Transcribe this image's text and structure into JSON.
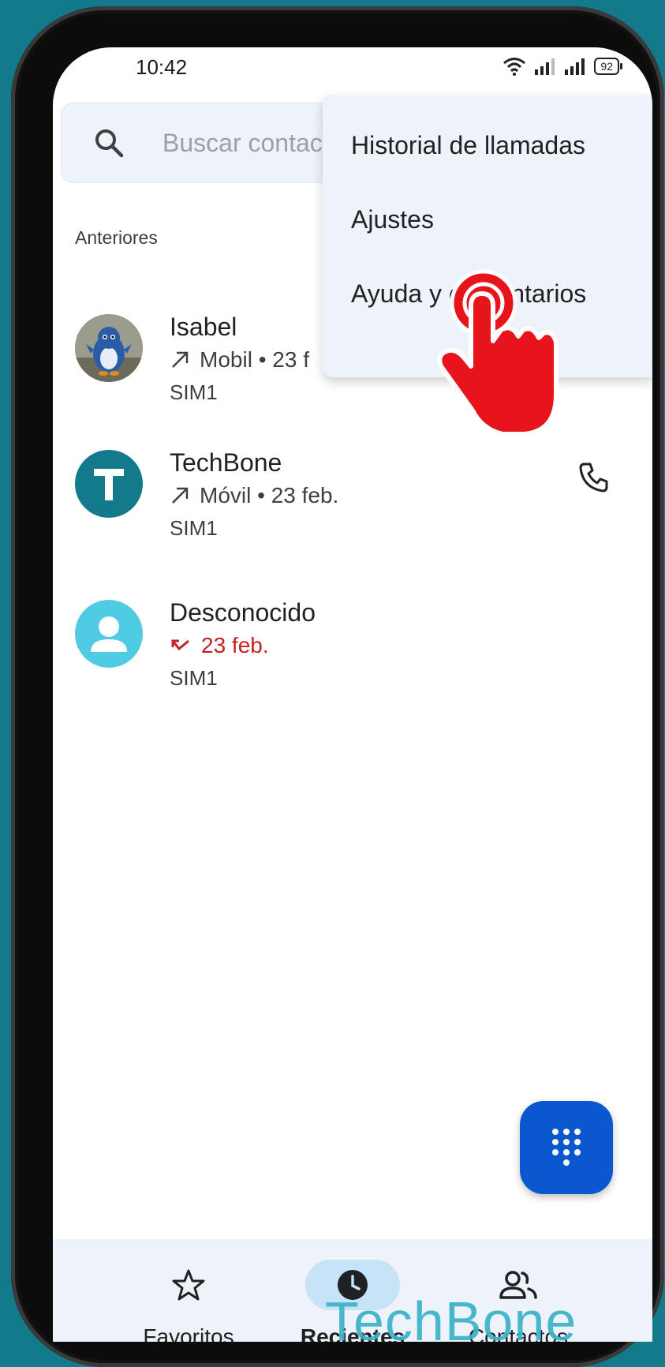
{
  "status_bar": {
    "time": "10:42",
    "battery": "92"
  },
  "search": {
    "placeholder": "Buscar contac"
  },
  "section": {
    "label": "Anteriores"
  },
  "calls": [
    {
      "name": "Isabel",
      "type": "Mobil • 23 f",
      "sim": "SIM1"
    },
    {
      "name": "TechBone",
      "type": "Móvil • 23 feb.",
      "sim": "SIM1",
      "avatar_letter": "T"
    },
    {
      "name": "Desconocido",
      "type": "23 feb.",
      "sim": "SIM1"
    }
  ],
  "menu": {
    "items": [
      {
        "label": "Historial de llamadas"
      },
      {
        "label": "Ajustes"
      },
      {
        "label": "Ayuda y comentarios"
      }
    ]
  },
  "nav": {
    "items": [
      {
        "label": "Favoritos"
      },
      {
        "label": "Recientes"
      },
      {
        "label": "Contactos"
      }
    ]
  },
  "watermark": "TechBone",
  "colors": {
    "background": "#137a8c",
    "fab": "#0b57d0",
    "active_nav": "#c6e3f7",
    "missed": "#c5221f",
    "techbone_avatar": "#137a8c",
    "unknown_avatar": "#4fcbe3",
    "tap_hand": "#e8141c"
  }
}
